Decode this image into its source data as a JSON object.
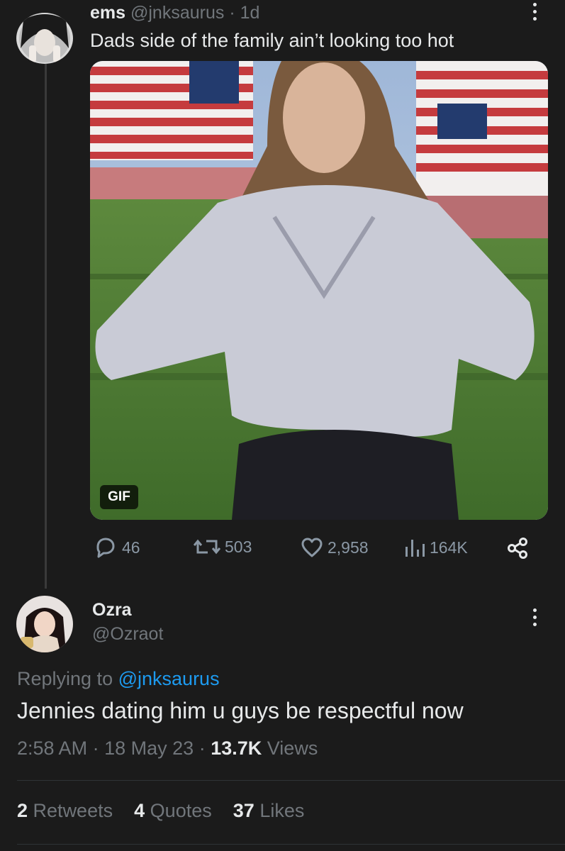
{
  "post": {
    "author_name": "ems",
    "handle": "@jnksaurus",
    "time": "1d",
    "text": "Dads side of the family ain’t looking too hot",
    "media_badge": "GIF",
    "actions": {
      "replies": "46",
      "retweets": "503",
      "likes": "2,958",
      "views": "164K"
    }
  },
  "reply": {
    "author_name": "Ozra",
    "handle": "@Ozraot",
    "replying_label": "Replying to",
    "replying_handle": "@jnksaurus",
    "text": "Jennies dating him u guys be respectful now",
    "time": "2:58 AM",
    "date": "18 May 23",
    "views_count": "13.7K",
    "views_label": "Views",
    "stats": {
      "retweets_count": "2",
      "retweets_label": "Retweets",
      "quotes_count": "4",
      "quotes_label": "Quotes",
      "likes_count": "37",
      "likes_label": "Likes"
    }
  },
  "colors": {
    "background": "#1b1b1b",
    "text": "#e7e9ea",
    "muted": "#71767b",
    "accent": "#1d9bf0"
  },
  "icons": [
    "reply-icon",
    "retweet-icon",
    "like-icon",
    "views-icon",
    "share-icon",
    "more-icon"
  ]
}
